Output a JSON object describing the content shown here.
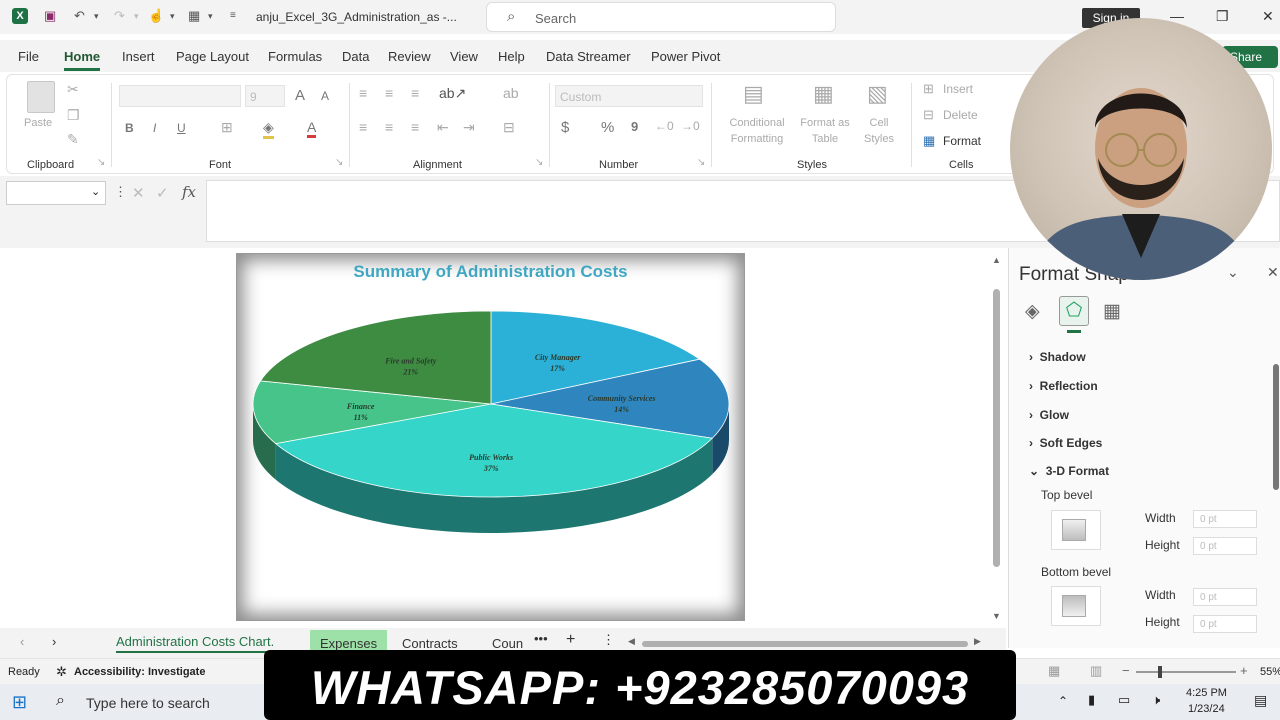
{
  "titlebar": {
    "filename": "anju_Excel_3G_Administration_as  -...",
    "search_placeholder": "Search",
    "signin": "Sign in",
    "share": "Share"
  },
  "ribbon_tabs": [
    "File",
    "Home",
    "Insert",
    "Page Layout",
    "Formulas",
    "Data",
    "Review",
    "View",
    "Help",
    "Data Streamer",
    "Power Pivot"
  ],
  "ribbon": {
    "clipboard": {
      "group": "Clipboard",
      "paste": "Paste"
    },
    "font": {
      "group": "Font",
      "size": "9",
      "bold": "B",
      "italic": "I",
      "underline": "U",
      "grow": "A",
      "shrink": "A"
    },
    "alignment": {
      "group": "Alignment"
    },
    "number": {
      "group": "Number",
      "format": "Custom",
      "currency": "$",
      "percent": "%",
      "comma": "9"
    },
    "styles": {
      "group": "Styles",
      "conditional": "Conditional Formatting",
      "format_table": "Format as Table",
      "cell_styles": "Cell Styles"
    },
    "cells": {
      "group": "Cells",
      "insert": "Insert",
      "delete": "Delete",
      "format": "Format"
    }
  },
  "formula_bar": {
    "fx": "fx",
    "cancel": "✕",
    "enter": "✓"
  },
  "chart_data": {
    "type": "pie",
    "title": "Summary of Administration Costs",
    "categories": [
      "City Manager",
      "Community Services",
      "Public Works",
      "Finance",
      "Fire and Safety"
    ],
    "values": [
      17,
      14,
      37,
      11,
      21
    ],
    "labels": [
      "17%",
      "14%",
      "37%",
      "11%",
      "21%"
    ],
    "colors": [
      "#2bb0d8",
      "#2f86bf",
      "#35d6c9",
      "#46c48a",
      "#3e8b42"
    ],
    "style": "3-D pie"
  },
  "format_pane": {
    "title": "Format Shape",
    "sections": [
      "Shadow",
      "Reflection",
      "Glow",
      "Soft Edges",
      "3-D Format"
    ],
    "top_bevel": "Top bevel",
    "bottom_bevel": "Bottom bevel",
    "width_label": "Width",
    "height_label": "Height",
    "zero_value": "0 pt"
  },
  "sheet_tabs": [
    "Administration Costs Chart.",
    "Expenses",
    "Contracts",
    "Coun"
  ],
  "status": {
    "ready": "Ready",
    "accessibility": "Accessibility: Investigate",
    "zoom": "55%"
  },
  "taskbar": {
    "search": "Type here to search",
    "time": "4:25 PM",
    "date": "1/23/24"
  },
  "overlay_banner": "WHATSAPP: +923285070093"
}
